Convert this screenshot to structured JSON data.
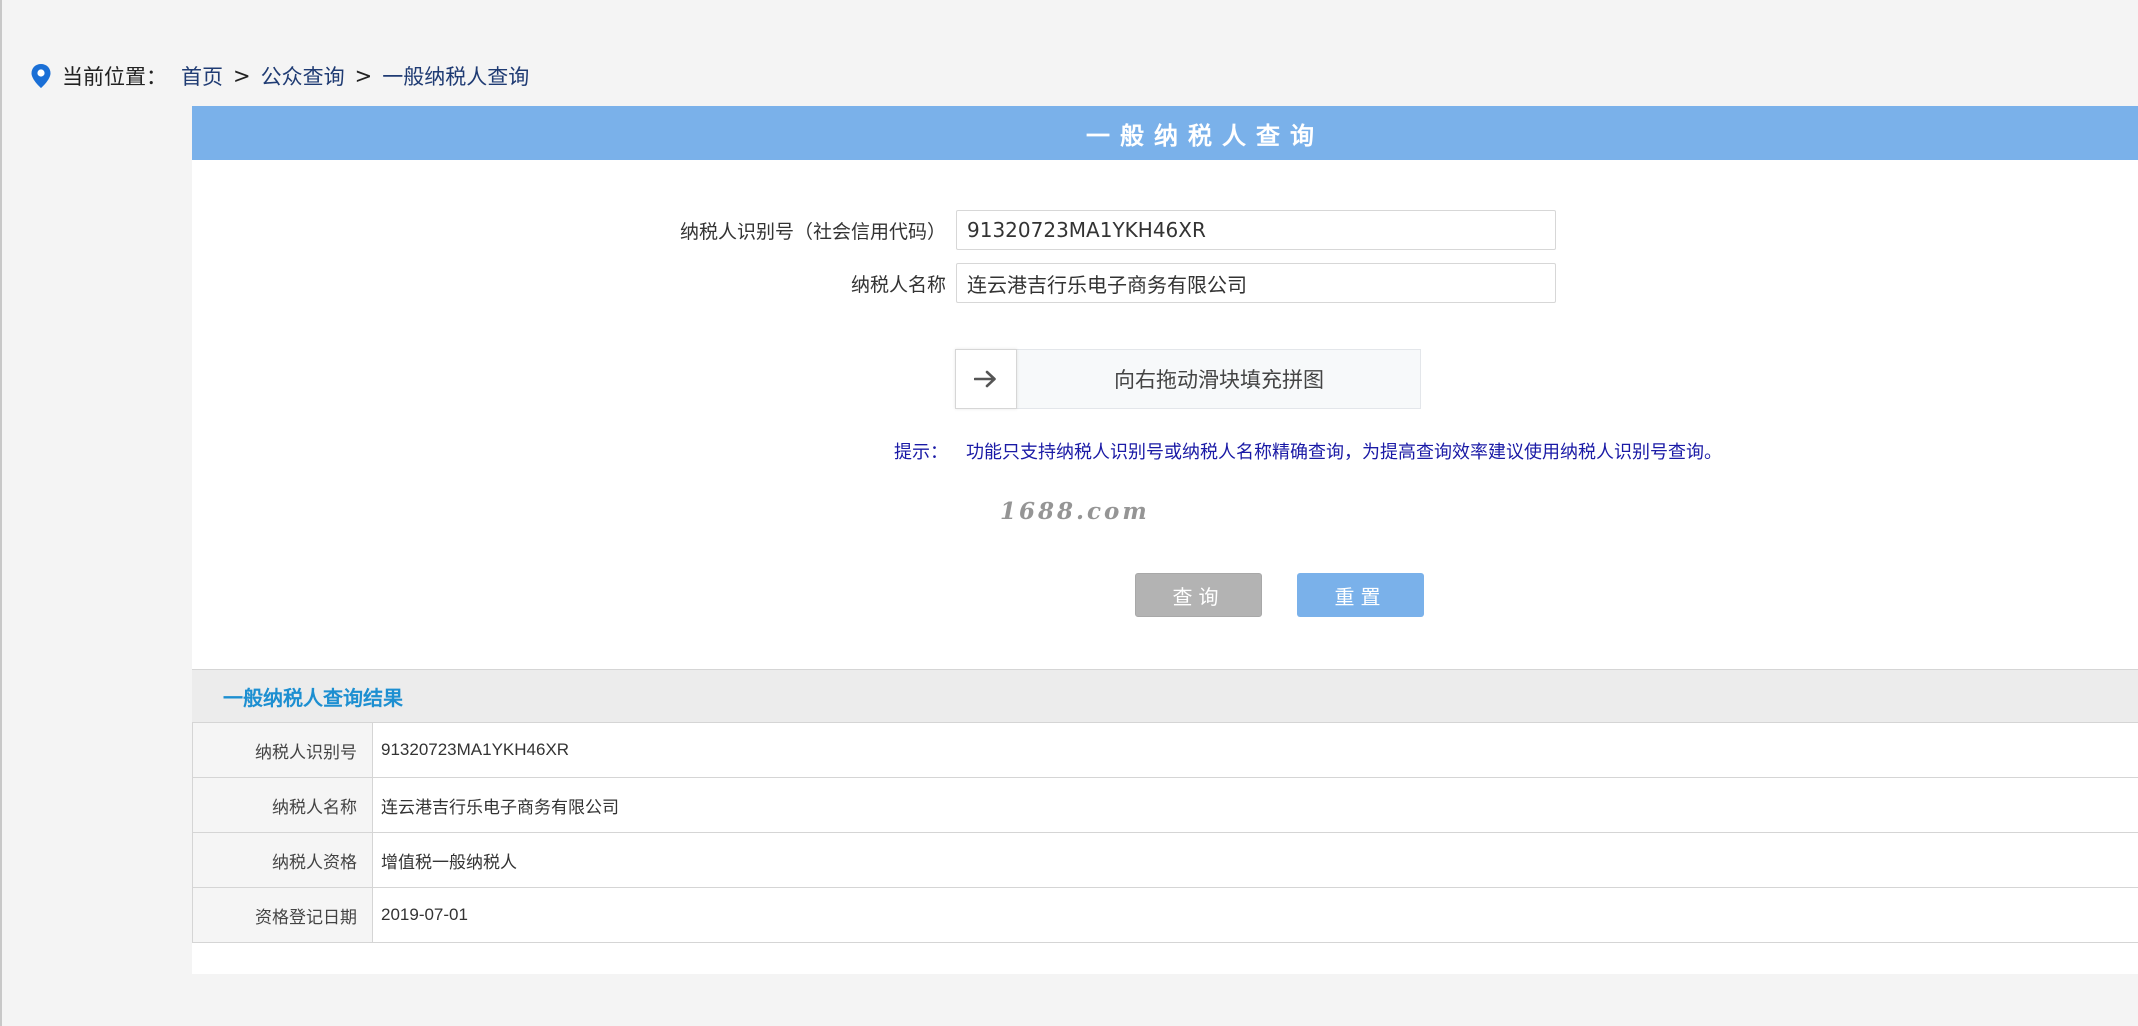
{
  "breadcrumb": {
    "label": "当前位置：",
    "items": [
      "首页",
      "公众查询",
      "一般纳税人查询"
    ],
    "separator": ">"
  },
  "panel": {
    "title": "一般纳税人查询"
  },
  "form": {
    "taxpayer_id": {
      "label": "纳税人识别号（社会信用代码）",
      "value": "91320723MA1YKH46XR"
    },
    "taxpayer_name": {
      "label": "纳税人名称",
      "value": "连云港吉行乐电子商务有限公司"
    }
  },
  "slider": {
    "text": "向右拖动滑块填充拼图",
    "icon": "arrow-right-icon"
  },
  "hint": {
    "label": "提示：",
    "text": "功能只支持纳税人识别号或纳税人名称精确查询，为提高查询效率建议使用纳税人识别号查询。"
  },
  "watermark": "1688.com",
  "buttons": {
    "query": "查询",
    "reset": "重置"
  },
  "result": {
    "title": "一般纳税人查询结果",
    "rows": [
      {
        "key": "纳税人识别号",
        "value": "91320723MA1YKH46XR"
      },
      {
        "key": "纳税人名称",
        "value": "连云港吉行乐电子商务有限公司"
      },
      {
        "key": "纳税人资格",
        "value": "增值税一般纳税人"
      },
      {
        "key": "资格登记日期",
        "value": "2019-07-01"
      }
    ]
  },
  "colors": {
    "header_blue": "#7ab1ea",
    "result_title_blue": "#1d8fd1",
    "hint_blue": "#1a1aa6",
    "query_button_gray": "#b3b3b3"
  }
}
